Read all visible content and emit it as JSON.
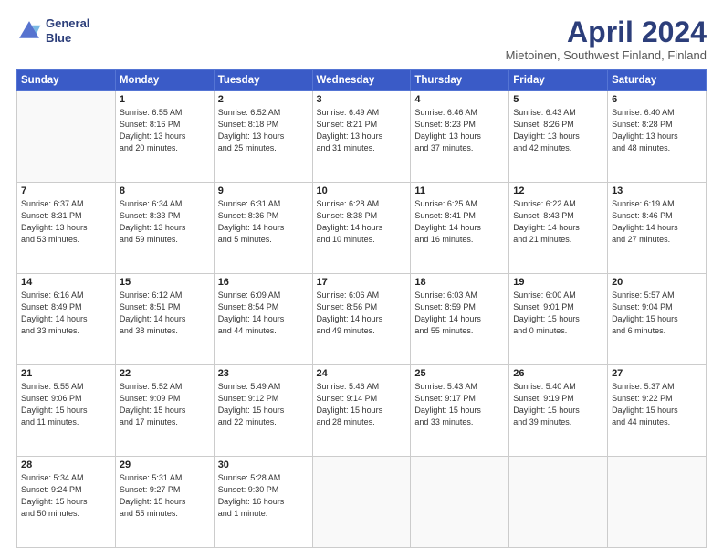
{
  "logo": {
    "line1": "General",
    "line2": "Blue"
  },
  "title": "April 2024",
  "subtitle": "Mietoinen, Southwest Finland, Finland",
  "days_header": [
    "Sunday",
    "Monday",
    "Tuesday",
    "Wednesday",
    "Thursday",
    "Friday",
    "Saturday"
  ],
  "weeks": [
    [
      {
        "num": "",
        "info": ""
      },
      {
        "num": "1",
        "info": "Sunrise: 6:55 AM\nSunset: 8:16 PM\nDaylight: 13 hours\nand 20 minutes."
      },
      {
        "num": "2",
        "info": "Sunrise: 6:52 AM\nSunset: 8:18 PM\nDaylight: 13 hours\nand 25 minutes."
      },
      {
        "num": "3",
        "info": "Sunrise: 6:49 AM\nSunset: 8:21 PM\nDaylight: 13 hours\nand 31 minutes."
      },
      {
        "num": "4",
        "info": "Sunrise: 6:46 AM\nSunset: 8:23 PM\nDaylight: 13 hours\nand 37 minutes."
      },
      {
        "num": "5",
        "info": "Sunrise: 6:43 AM\nSunset: 8:26 PM\nDaylight: 13 hours\nand 42 minutes."
      },
      {
        "num": "6",
        "info": "Sunrise: 6:40 AM\nSunset: 8:28 PM\nDaylight: 13 hours\nand 48 minutes."
      }
    ],
    [
      {
        "num": "7",
        "info": "Sunrise: 6:37 AM\nSunset: 8:31 PM\nDaylight: 13 hours\nand 53 minutes."
      },
      {
        "num": "8",
        "info": "Sunrise: 6:34 AM\nSunset: 8:33 PM\nDaylight: 13 hours\nand 59 minutes."
      },
      {
        "num": "9",
        "info": "Sunrise: 6:31 AM\nSunset: 8:36 PM\nDaylight: 14 hours\nand 5 minutes."
      },
      {
        "num": "10",
        "info": "Sunrise: 6:28 AM\nSunset: 8:38 PM\nDaylight: 14 hours\nand 10 minutes."
      },
      {
        "num": "11",
        "info": "Sunrise: 6:25 AM\nSunset: 8:41 PM\nDaylight: 14 hours\nand 16 minutes."
      },
      {
        "num": "12",
        "info": "Sunrise: 6:22 AM\nSunset: 8:43 PM\nDaylight: 14 hours\nand 21 minutes."
      },
      {
        "num": "13",
        "info": "Sunrise: 6:19 AM\nSunset: 8:46 PM\nDaylight: 14 hours\nand 27 minutes."
      }
    ],
    [
      {
        "num": "14",
        "info": "Sunrise: 6:16 AM\nSunset: 8:49 PM\nDaylight: 14 hours\nand 33 minutes."
      },
      {
        "num": "15",
        "info": "Sunrise: 6:12 AM\nSunset: 8:51 PM\nDaylight: 14 hours\nand 38 minutes."
      },
      {
        "num": "16",
        "info": "Sunrise: 6:09 AM\nSunset: 8:54 PM\nDaylight: 14 hours\nand 44 minutes."
      },
      {
        "num": "17",
        "info": "Sunrise: 6:06 AM\nSunset: 8:56 PM\nDaylight: 14 hours\nand 49 minutes."
      },
      {
        "num": "18",
        "info": "Sunrise: 6:03 AM\nSunset: 8:59 PM\nDaylight: 14 hours\nand 55 minutes."
      },
      {
        "num": "19",
        "info": "Sunrise: 6:00 AM\nSunset: 9:01 PM\nDaylight: 15 hours\nand 0 minutes."
      },
      {
        "num": "20",
        "info": "Sunrise: 5:57 AM\nSunset: 9:04 PM\nDaylight: 15 hours\nand 6 minutes."
      }
    ],
    [
      {
        "num": "21",
        "info": "Sunrise: 5:55 AM\nSunset: 9:06 PM\nDaylight: 15 hours\nand 11 minutes."
      },
      {
        "num": "22",
        "info": "Sunrise: 5:52 AM\nSunset: 9:09 PM\nDaylight: 15 hours\nand 17 minutes."
      },
      {
        "num": "23",
        "info": "Sunrise: 5:49 AM\nSunset: 9:12 PM\nDaylight: 15 hours\nand 22 minutes."
      },
      {
        "num": "24",
        "info": "Sunrise: 5:46 AM\nSunset: 9:14 PM\nDaylight: 15 hours\nand 28 minutes."
      },
      {
        "num": "25",
        "info": "Sunrise: 5:43 AM\nSunset: 9:17 PM\nDaylight: 15 hours\nand 33 minutes."
      },
      {
        "num": "26",
        "info": "Sunrise: 5:40 AM\nSunset: 9:19 PM\nDaylight: 15 hours\nand 39 minutes."
      },
      {
        "num": "27",
        "info": "Sunrise: 5:37 AM\nSunset: 9:22 PM\nDaylight: 15 hours\nand 44 minutes."
      }
    ],
    [
      {
        "num": "28",
        "info": "Sunrise: 5:34 AM\nSunset: 9:24 PM\nDaylight: 15 hours\nand 50 minutes."
      },
      {
        "num": "29",
        "info": "Sunrise: 5:31 AM\nSunset: 9:27 PM\nDaylight: 15 hours\nand 55 minutes."
      },
      {
        "num": "30",
        "info": "Sunrise: 5:28 AM\nSunset: 9:30 PM\nDaylight: 16 hours\nand 1 minute."
      },
      {
        "num": "",
        "info": ""
      },
      {
        "num": "",
        "info": ""
      },
      {
        "num": "",
        "info": ""
      },
      {
        "num": "",
        "info": ""
      }
    ]
  ]
}
